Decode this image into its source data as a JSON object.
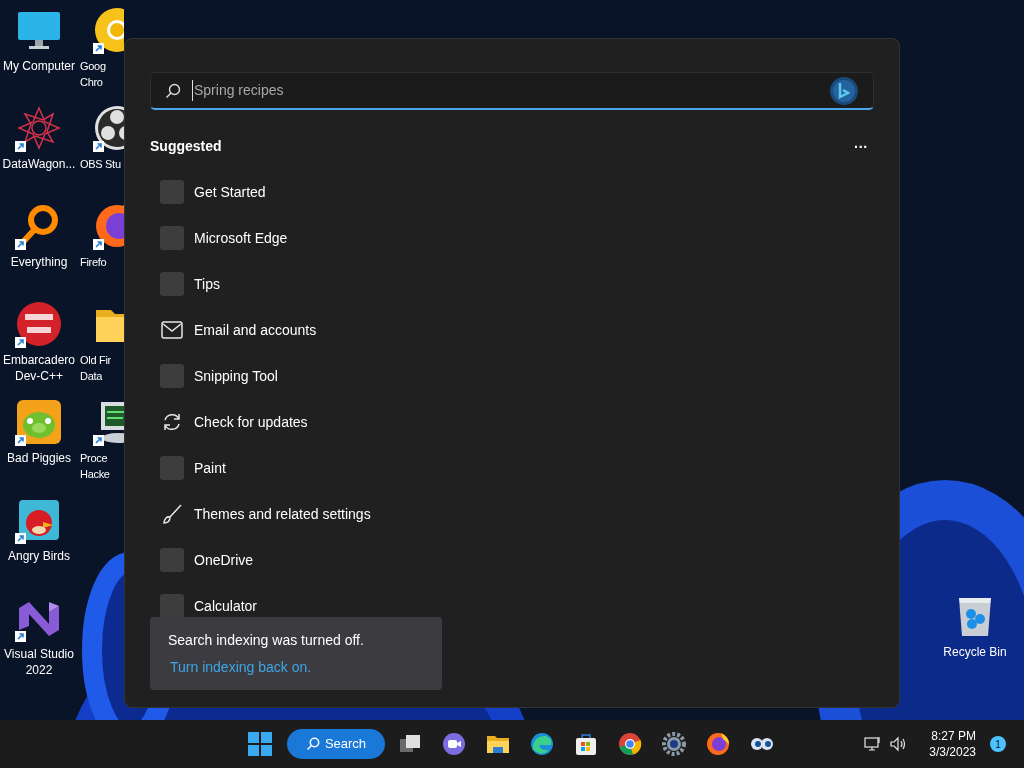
{
  "desktop_icons_column_1": [
    {
      "kind": "monitor",
      "lines": [
        "My Computer"
      ],
      "shortcut": false
    },
    {
      "kind": "star",
      "lines": [
        "DataWagon..."
      ],
      "shortcut": true
    },
    {
      "kind": "ring",
      "lines": [
        "Everything"
      ],
      "shortcut": true
    },
    {
      "kind": "devcpp",
      "lines": [
        "Embarcadero",
        "Dev-C++"
      ],
      "shortcut": true
    },
    {
      "kind": "pig",
      "lines": [
        "Bad Piggies"
      ],
      "shortcut": true
    },
    {
      "kind": "bird",
      "lines": [
        "Angry Birds"
      ],
      "shortcut": true
    },
    {
      "kind": "vs",
      "lines": [
        "Visual Studio",
        "2022"
      ],
      "shortcut": true
    }
  ],
  "desktop_icons_column_2": [
    {
      "kind": "chrome",
      "lines": [
        "Goog",
        "Chro"
      ],
      "shortcut": true
    },
    {
      "kind": "obs",
      "lines": [
        "OBS Stu"
      ],
      "shortcut": true
    },
    {
      "kind": "firefox",
      "lines": [
        "Firefo"
      ],
      "shortcut": true
    },
    {
      "kind": "folder",
      "lines": [
        "Old Fir",
        "Data"
      ],
      "shortcut": false
    },
    {
      "kind": "hacker",
      "lines": [
        "Proce",
        "Hacke"
      ],
      "shortcut": true
    }
  ],
  "recycle_bin": {
    "kind": "recycle",
    "lines": [
      "Recycle Bin"
    ],
    "shortcut": false
  },
  "search_panel": {
    "search": {
      "placeholder": "Spring recipes"
    },
    "heading": "Suggested",
    "more": "···",
    "items": [
      {
        "kind": "app",
        "label": "Get Started"
      },
      {
        "kind": "app",
        "label": "Microsoft Edge"
      },
      {
        "kind": "app",
        "label": "Tips"
      },
      {
        "kind": "mail",
        "label": "Email and accounts"
      },
      {
        "kind": "app",
        "label": "Snipping Tool"
      },
      {
        "kind": "refresh",
        "label": "Check for updates"
      },
      {
        "kind": "app",
        "label": "Paint"
      },
      {
        "kind": "brush",
        "label": "Themes and related settings"
      },
      {
        "kind": "app",
        "label": "OneDrive"
      },
      {
        "kind": "app",
        "label": "Calculator"
      }
    ],
    "notice": {
      "message": "Search indexing was turned off.",
      "link": "Turn indexing back on."
    }
  },
  "taskbar": {
    "search_button": "Search",
    "apps": [
      {
        "kind": "taskview"
      },
      {
        "kind": "chat"
      },
      {
        "kind": "explorer"
      },
      {
        "kind": "edge"
      },
      {
        "kind": "store"
      },
      {
        "kind": "chrome"
      },
      {
        "kind": "settings"
      },
      {
        "kind": "firefox"
      },
      {
        "kind": "eyes"
      }
    ],
    "time": "8:27 PM",
    "date": "3/3/2023",
    "notification_count": "1"
  }
}
